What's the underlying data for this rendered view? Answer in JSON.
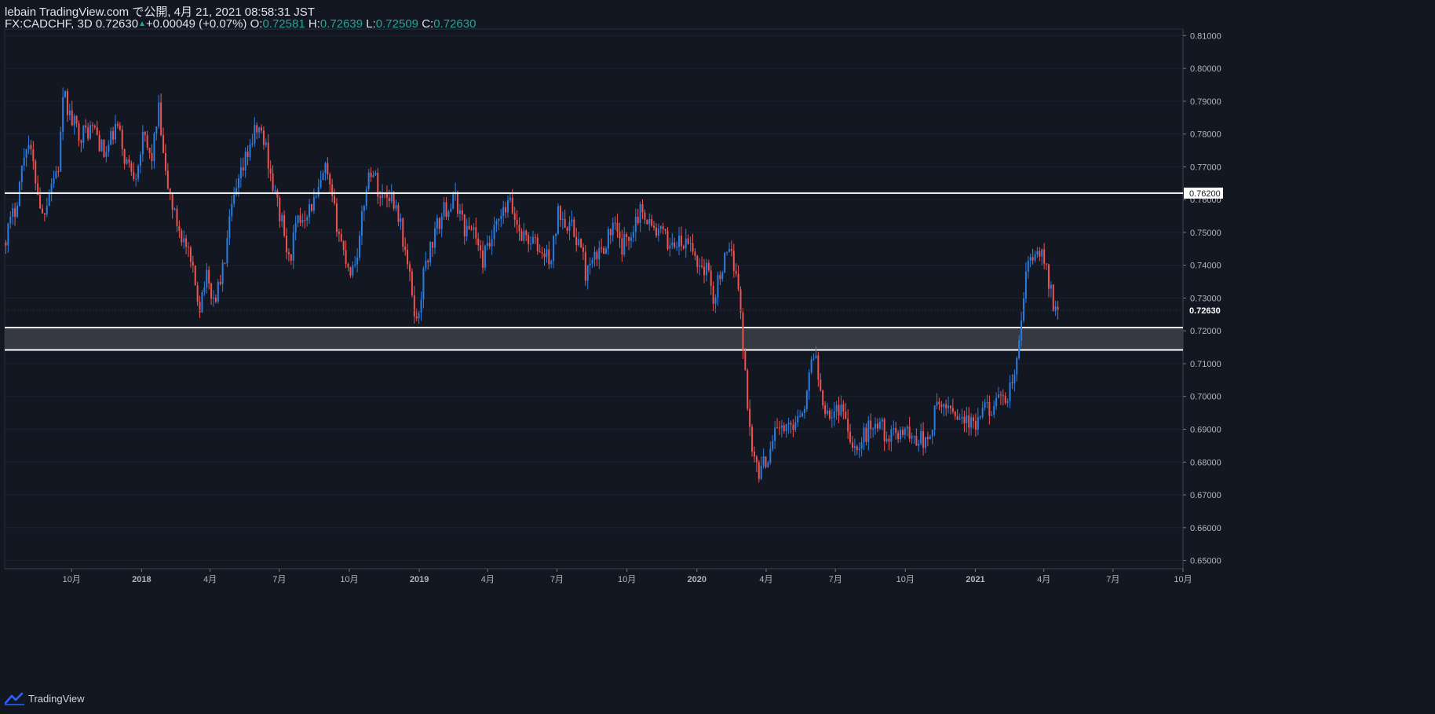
{
  "header": {
    "published": "lebain TradingView.com で公開, 4月 21, 2021 08:58:31 JST",
    "symbol": "FX:CADCHF, 3D",
    "last": "0.72630",
    "change": "+0.00049 (+0.07%)",
    "o_label": "O:",
    "o_value": "0.72581",
    "h_label": "H:",
    "h_value": "0.72639",
    "l_label": "L:",
    "l_value": "0.72509",
    "c_label": "C:",
    "c_value": "0.72630"
  },
  "footer": {
    "brand": "TradingView"
  },
  "colors": {
    "background": "#131722",
    "up": "#2a7de1",
    "down": "#ef5350",
    "level_line": "#ffffff",
    "zone_fill": "#3a3d45",
    "axis_text": "#b2b5be",
    "grid": "#1e2230"
  },
  "chart_data": {
    "type": "candlestick",
    "symbol": "FX:CADCHF",
    "timeframe": "3D",
    "y_axis": {
      "range": [
        0.6475,
        0.812
      ],
      "ticks": [
        "0.81000",
        "0.80000",
        "0.79000",
        "0.78000",
        "0.77000",
        "0.76000",
        "0.75000",
        "0.74000",
        "0.73000",
        "0.72000",
        "0.71000",
        "0.70000",
        "0.69000",
        "0.68000",
        "0.67000",
        "0.66000",
        "0.65000"
      ]
    },
    "x_axis": {
      "range": [
        "2017-07-05",
        "2021-10-01"
      ],
      "ticks": [
        {
          "label": "10月",
          "date": "2017-10-01"
        },
        {
          "label": "2018",
          "date": "2018-01-01"
        },
        {
          "label": "4月",
          "date": "2018-04-01"
        },
        {
          "label": "7月",
          "date": "2018-07-01"
        },
        {
          "label": "10月",
          "date": "2018-10-01"
        },
        {
          "label": "2019",
          "date": "2019-01-01"
        },
        {
          "label": "4月",
          "date": "2019-04-01"
        },
        {
          "label": "7月",
          "date": "2019-07-01"
        },
        {
          "label": "10月",
          "date": "2019-10-01"
        },
        {
          "label": "2020",
          "date": "2020-01-01"
        },
        {
          "label": "4月",
          "date": "2020-04-01"
        },
        {
          "label": "7月",
          "date": "2020-07-01"
        },
        {
          "label": "10月",
          "date": "2020-10-01"
        },
        {
          "label": "2021",
          "date": "2021-01-01"
        },
        {
          "label": "4月",
          "date": "2021-04-01"
        },
        {
          "label": "7月",
          "date": "2021-07-01"
        },
        {
          "label": "10月",
          "date": "2021-10-01"
        }
      ]
    },
    "horizontal_lines": [
      {
        "price": 0.762,
        "label": "0.76200"
      }
    ],
    "zone": {
      "top": 0.721,
      "bottom": 0.7142
    },
    "last_price": {
      "price": 0.7263,
      "label": "0.72630"
    },
    "closes": [
      {
        "date": "2017-07-05",
        "close": 0.747
      },
      {
        "date": "2017-07-20",
        "close": 0.757
      },
      {
        "date": "2017-08-05",
        "close": 0.779
      },
      {
        "date": "2017-08-15",
        "close": 0.768
      },
      {
        "date": "2017-08-25",
        "close": 0.755
      },
      {
        "date": "2017-09-05",
        "close": 0.765
      },
      {
        "date": "2017-09-15",
        "close": 0.77
      },
      {
        "date": "2017-09-22",
        "close": 0.792
      },
      {
        "date": "2017-10-02",
        "close": 0.784
      },
      {
        "date": "2017-10-15",
        "close": 0.78
      },
      {
        "date": "2017-11-01",
        "close": 0.782
      },
      {
        "date": "2017-11-15",
        "close": 0.773
      },
      {
        "date": "2017-12-01",
        "close": 0.783
      },
      {
        "date": "2017-12-12",
        "close": 0.772
      },
      {
        "date": "2017-12-25",
        "close": 0.768
      },
      {
        "date": "2018-01-05",
        "close": 0.779
      },
      {
        "date": "2018-01-15",
        "close": 0.772
      },
      {
        "date": "2018-01-25",
        "close": 0.787
      },
      {
        "date": "2018-02-02",
        "close": 0.768
      },
      {
        "date": "2018-02-15",
        "close": 0.755
      },
      {
        "date": "2018-03-01",
        "close": 0.746
      },
      {
        "date": "2018-03-10",
        "close": 0.738
      },
      {
        "date": "2018-03-20",
        "close": 0.728
      },
      {
        "date": "2018-03-27",
        "close": 0.737
      },
      {
        "date": "2018-04-08",
        "close": 0.729
      },
      {
        "date": "2018-04-20",
        "close": 0.739
      },
      {
        "date": "2018-05-01",
        "close": 0.757
      },
      {
        "date": "2018-05-12",
        "close": 0.766
      },
      {
        "date": "2018-05-25",
        "close": 0.777
      },
      {
        "date": "2018-06-05",
        "close": 0.782
      },
      {
        "date": "2018-06-15",
        "close": 0.776
      },
      {
        "date": "2018-06-25",
        "close": 0.763
      },
      {
        "date": "2018-07-05",
        "close": 0.754
      },
      {
        "date": "2018-07-15",
        "close": 0.741
      },
      {
        "date": "2018-07-25",
        "close": 0.752
      },
      {
        "date": "2018-08-05",
        "close": 0.756
      },
      {
        "date": "2018-08-20",
        "close": 0.76
      },
      {
        "date": "2018-09-01",
        "close": 0.769
      },
      {
        "date": "2018-09-12",
        "close": 0.757
      },
      {
        "date": "2018-09-25",
        "close": 0.744
      },
      {
        "date": "2018-10-05",
        "close": 0.738
      },
      {
        "date": "2018-10-15",
        "close": 0.746
      },
      {
        "date": "2018-10-25",
        "close": 0.765
      },
      {
        "date": "2018-11-01",
        "close": 0.77
      },
      {
        "date": "2018-11-12",
        "close": 0.761
      },
      {
        "date": "2018-11-25",
        "close": 0.762
      },
      {
        "date": "2018-12-05",
        "close": 0.757
      },
      {
        "date": "2018-12-15",
        "close": 0.744
      },
      {
        "date": "2018-12-25",
        "close": 0.73
      },
      {
        "date": "2018-12-30",
        "close": 0.722
      },
      {
        "date": "2019-01-10",
        "close": 0.74
      },
      {
        "date": "2019-01-25",
        "close": 0.751
      },
      {
        "date": "2019-02-05",
        "close": 0.757
      },
      {
        "date": "2019-02-20",
        "close": 0.76
      },
      {
        "date": "2019-03-05",
        "close": 0.75
      },
      {
        "date": "2019-03-15",
        "close": 0.752
      },
      {
        "date": "2019-03-25",
        "close": 0.741
      },
      {
        "date": "2019-04-05",
        "close": 0.746
      },
      {
        "date": "2019-04-15",
        "close": 0.752
      },
      {
        "date": "2019-05-01",
        "close": 0.759
      },
      {
        "date": "2019-05-15",
        "close": 0.75
      },
      {
        "date": "2019-06-01",
        "close": 0.747
      },
      {
        "date": "2019-06-15",
        "close": 0.743
      },
      {
        "date": "2019-06-25",
        "close": 0.742
      },
      {
        "date": "2019-07-05",
        "close": 0.757
      },
      {
        "date": "2019-07-20",
        "close": 0.752
      },
      {
        "date": "2019-08-01",
        "close": 0.747
      },
      {
        "date": "2019-08-10",
        "close": 0.737
      },
      {
        "date": "2019-08-20",
        "close": 0.741
      },
      {
        "date": "2019-08-30",
        "close": 0.745
      },
      {
        "date": "2019-09-15",
        "close": 0.752
      },
      {
        "date": "2019-09-25",
        "close": 0.745
      },
      {
        "date": "2019-10-05",
        "close": 0.749
      },
      {
        "date": "2019-10-15",
        "close": 0.755
      },
      {
        "date": "2019-10-25",
        "close": 0.757
      },
      {
        "date": "2019-11-05",
        "close": 0.751
      },
      {
        "date": "2019-11-15",
        "close": 0.75
      },
      {
        "date": "2019-11-25",
        "close": 0.747
      },
      {
        "date": "2019-12-05",
        "close": 0.747
      },
      {
        "date": "2019-12-15",
        "close": 0.746
      },
      {
        "date": "2019-12-25",
        "close": 0.746
      },
      {
        "date": "2020-01-05",
        "close": 0.74
      },
      {
        "date": "2020-01-15",
        "close": 0.739
      },
      {
        "date": "2020-01-25",
        "close": 0.73
      },
      {
        "date": "2020-02-05",
        "close": 0.74
      },
      {
        "date": "2020-02-15",
        "close": 0.743
      },
      {
        "date": "2020-02-25",
        "close": 0.738
      },
      {
        "date": "2020-03-01",
        "close": 0.721
      },
      {
        "date": "2020-03-10",
        "close": 0.695
      },
      {
        "date": "2020-03-18",
        "close": 0.68
      },
      {
        "date": "2020-03-25",
        "close": 0.677
      },
      {
        "date": "2020-04-05",
        "close": 0.682
      },
      {
        "date": "2020-04-15",
        "close": 0.692
      },
      {
        "date": "2020-04-25",
        "close": 0.689
      },
      {
        "date": "2020-05-05",
        "close": 0.691
      },
      {
        "date": "2020-05-15",
        "close": 0.695
      },
      {
        "date": "2020-05-25",
        "close": 0.699
      },
      {
        "date": "2020-06-05",
        "close": 0.716
      },
      {
        "date": "2020-06-12",
        "close": 0.702
      },
      {
        "date": "2020-06-20",
        "close": 0.697
      },
      {
        "date": "2020-06-30",
        "close": 0.694
      },
      {
        "date": "2020-07-10",
        "close": 0.698
      },
      {
        "date": "2020-07-20",
        "close": 0.69
      },
      {
        "date": "2020-07-30",
        "close": 0.683
      },
      {
        "date": "2020-08-10",
        "close": 0.688
      },
      {
        "date": "2020-08-20",
        "close": 0.692
      },
      {
        "date": "2020-09-01",
        "close": 0.691
      },
      {
        "date": "2020-09-10",
        "close": 0.687
      },
      {
        "date": "2020-09-20",
        "close": 0.688
      },
      {
        "date": "2020-10-01",
        "close": 0.691
      },
      {
        "date": "2020-10-10",
        "close": 0.687
      },
      {
        "date": "2020-10-20",
        "close": 0.688
      },
      {
        "date": "2020-11-01",
        "close": 0.685
      },
      {
        "date": "2020-11-10",
        "close": 0.695
      },
      {
        "date": "2020-11-20",
        "close": 0.697
      },
      {
        "date": "2020-12-01",
        "close": 0.697
      },
      {
        "date": "2020-12-10",
        "close": 0.695
      },
      {
        "date": "2020-12-20",
        "close": 0.693
      },
      {
        "date": "2021-01-01",
        "close": 0.69
      },
      {
        "date": "2021-01-10",
        "close": 0.694
      },
      {
        "date": "2021-01-20",
        "close": 0.697
      },
      {
        "date": "2021-02-01",
        "close": 0.698
      },
      {
        "date": "2021-02-10",
        "close": 0.697
      },
      {
        "date": "2021-02-20",
        "close": 0.705
      },
      {
        "date": "2021-02-27",
        "close": 0.71
      },
      {
        "date": "2021-03-03",
        "close": 0.722
      },
      {
        "date": "2021-03-08",
        "close": 0.732
      },
      {
        "date": "2021-03-14",
        "close": 0.744
      },
      {
        "date": "2021-03-21",
        "close": 0.74
      },
      {
        "date": "2021-03-27",
        "close": 0.745
      },
      {
        "date": "2021-04-02",
        "close": 0.741
      },
      {
        "date": "2021-04-08",
        "close": 0.737
      },
      {
        "date": "2021-04-15",
        "close": 0.728
      },
      {
        "date": "2021-04-20",
        "close": 0.7263
      }
    ]
  }
}
